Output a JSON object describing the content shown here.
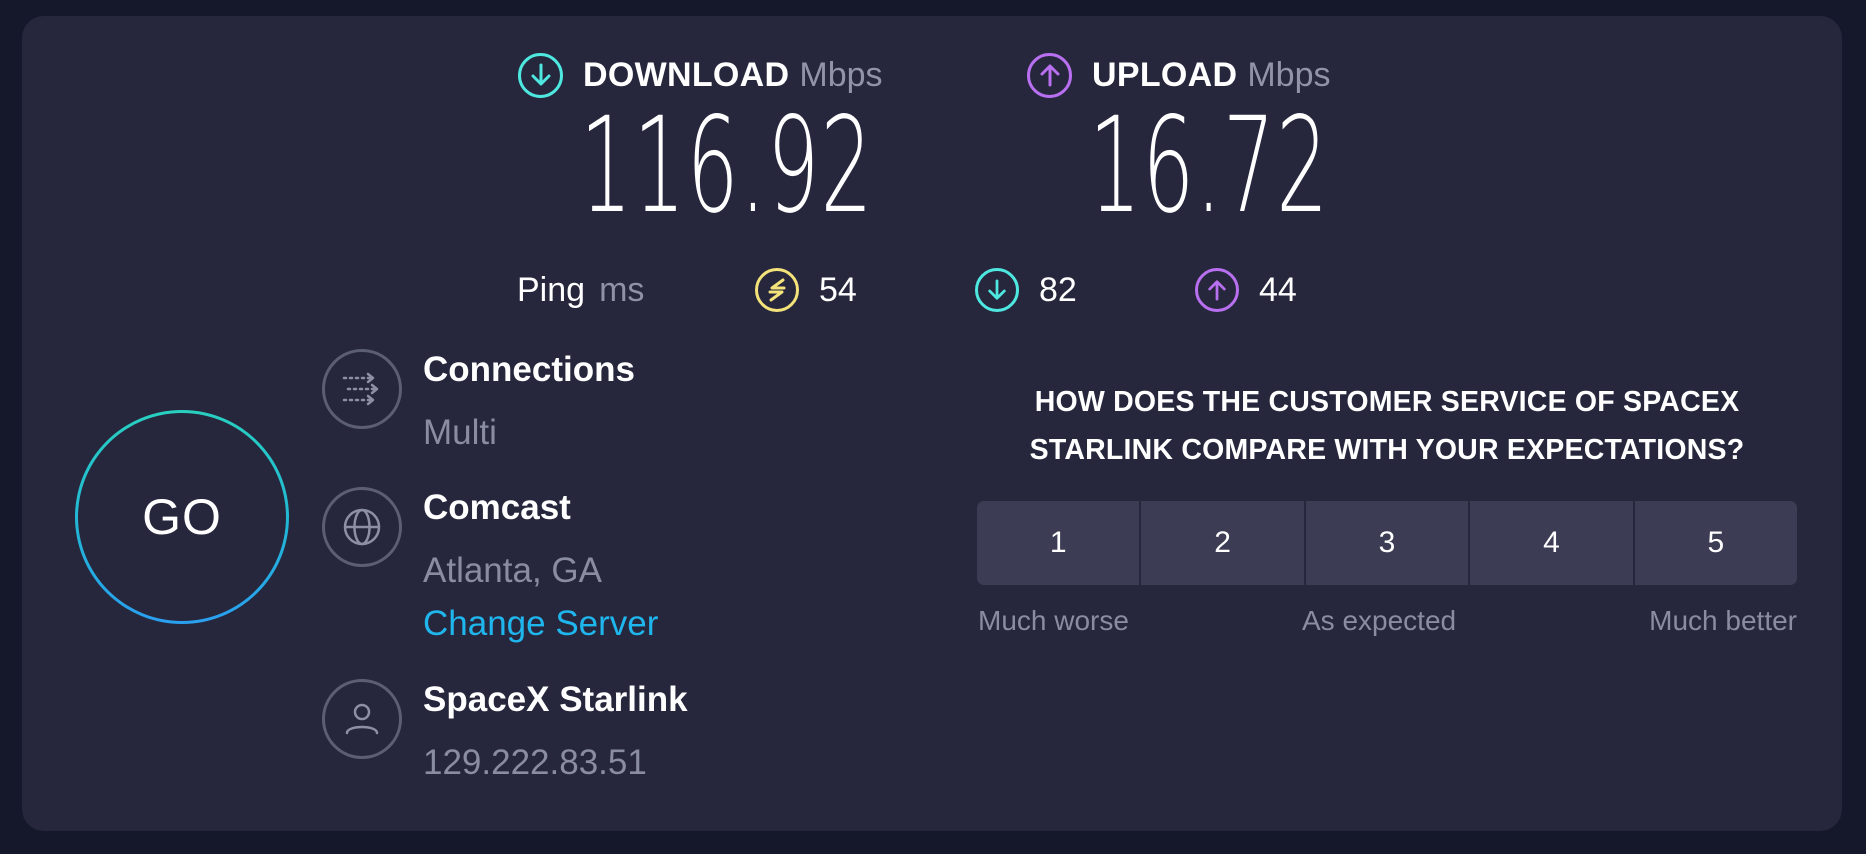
{
  "download": {
    "label": "DOWNLOAD",
    "unit": "Mbps",
    "value": "116.92",
    "icon": "arrow-down-circle-icon",
    "color": "#4ee8e0"
  },
  "upload": {
    "label": "UPLOAD",
    "unit": "Mbps",
    "value": "16.72",
    "icon": "arrow-up-circle-icon",
    "color": "#b86ff0"
  },
  "ping": {
    "label": "Ping",
    "unit": "ms",
    "idle": {
      "value": "54",
      "icon": "ping-swap-icon",
      "color": "#f4e27a"
    },
    "download": {
      "value": "82",
      "icon": "arrow-down-circle-icon",
      "color": "#4ee8e0"
    },
    "upload": {
      "value": "44",
      "icon": "arrow-up-circle-icon",
      "color": "#b86ff0"
    }
  },
  "go_button": {
    "label": "GO"
  },
  "info": {
    "connections": {
      "title": "Connections",
      "value": "Multi",
      "icon": "connections-icon"
    },
    "server": {
      "title": "Comcast",
      "location": "Atlanta, GA",
      "change_link": "Change Server",
      "icon": "globe-icon"
    },
    "provider": {
      "title": "SpaceX Starlink",
      "ip": "129.222.83.51",
      "icon": "user-icon"
    }
  },
  "survey": {
    "question": "HOW DOES THE CUSTOMER SERVICE OF SPACEX STARLINK COMPARE WITH YOUR EXPECTATIONS?",
    "options": [
      "1",
      "2",
      "3",
      "4",
      "5"
    ],
    "scale_labels": {
      "low": "Much worse",
      "mid": "As expected",
      "high": "Much better"
    }
  },
  "colors": {
    "background": "#15172a",
    "card": "#26273c",
    "link": "#1fb6ee",
    "muted_text": "#8a8ca2",
    "rating_button": "#3c3d54"
  }
}
